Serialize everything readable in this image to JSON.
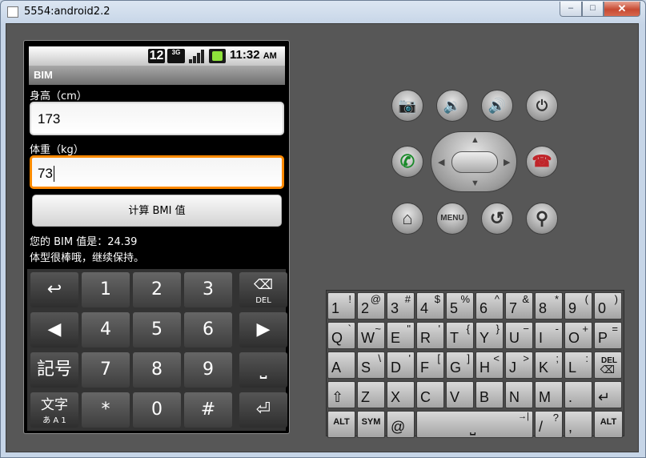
{
  "window": {
    "title": "5554:android2.2",
    "minimize": "–",
    "maximize": "□",
    "close": "✕"
  },
  "statusbar": {
    "badge12": "12",
    "network": "3G",
    "time": "11:32",
    "ampm": "AM"
  },
  "app": {
    "title": "BIM",
    "height_label": "身高（cm）",
    "height_value": "173",
    "weight_label": "体重（kg）",
    "weight_value": "73",
    "calc_button": "计算 BMI 值",
    "result_line1": "您的 BIM 值是：24.39",
    "result_line2": "体型很棒哦，继续保持。"
  },
  "numeric_keyboard": {
    "keys": [
      {
        "label": "↩"
      },
      {
        "label": "1"
      },
      {
        "label": "2"
      },
      {
        "label": "3"
      },
      {
        "label": "⌫",
        "sub": "DEL"
      },
      {
        "label": "◀"
      },
      {
        "label": "4"
      },
      {
        "label": "5"
      },
      {
        "label": "6"
      },
      {
        "label": "▶"
      },
      {
        "label": "記号"
      },
      {
        "label": "7"
      },
      {
        "label": "8"
      },
      {
        "label": "9"
      },
      {
        "label": "⎵"
      },
      {
        "label": "文字",
        "sub": "あ A 1"
      },
      {
        "label": "*"
      },
      {
        "label": "0"
      },
      {
        "label": "#"
      },
      {
        "label": "⏎"
      }
    ]
  },
  "hardware": {
    "camera": "📷",
    "vol_down": "🔉",
    "vol_up": "🔊",
    "power": "⏻",
    "call": "✆",
    "end_call": "☎",
    "home": "⌂",
    "menu": "MENU",
    "back": "↺",
    "search": "⚲"
  },
  "qwerty": {
    "row1": [
      [
        "1",
        "!"
      ],
      [
        "2",
        "@"
      ],
      [
        "3",
        "#"
      ],
      [
        "4",
        "$"
      ],
      [
        "5",
        "%"
      ],
      [
        "6",
        "^"
      ],
      [
        "7",
        "&"
      ],
      [
        "8",
        "*"
      ],
      [
        "9",
        "("
      ],
      [
        "0",
        ")"
      ]
    ],
    "row2": [
      [
        "Q",
        "`"
      ],
      [
        "W",
        "~"
      ],
      [
        "E",
        "\""
      ],
      [
        "R",
        "'"
      ],
      [
        "T",
        "{"
      ],
      [
        "Y",
        "}"
      ],
      [
        "U",
        "−"
      ],
      [
        "I",
        "-"
      ],
      [
        "O",
        "+"
      ],
      [
        "P",
        "="
      ]
    ],
    "row3": [
      [
        "A",
        ""
      ],
      [
        "S",
        "\\"
      ],
      [
        "D",
        "'"
      ],
      [
        "F",
        "["
      ],
      [
        "G",
        "]"
      ],
      [
        "H",
        "<"
      ],
      [
        "J",
        ">"
      ],
      [
        "K",
        ";"
      ],
      [
        "L",
        ":"
      ],
      [
        "DEL",
        "⌫"
      ]
    ],
    "row4": [
      [
        "⇧",
        ""
      ],
      [
        "Z",
        ""
      ],
      [
        "X",
        ""
      ],
      [
        "C",
        ""
      ],
      [
        "V",
        ""
      ],
      [
        "B",
        ""
      ],
      [
        "N",
        ""
      ],
      [
        "M",
        ""
      ],
      [
        ".",
        ""
      ],
      [
        "↵",
        ""
      ]
    ],
    "row5": {
      "alt": "ALT",
      "sym": "SYM",
      "at": "@",
      "space": "⎵",
      "tab": "→|",
      "slash": "/",
      "q": "?",
      "comma": ",",
      "alt2": "ALT"
    }
  }
}
